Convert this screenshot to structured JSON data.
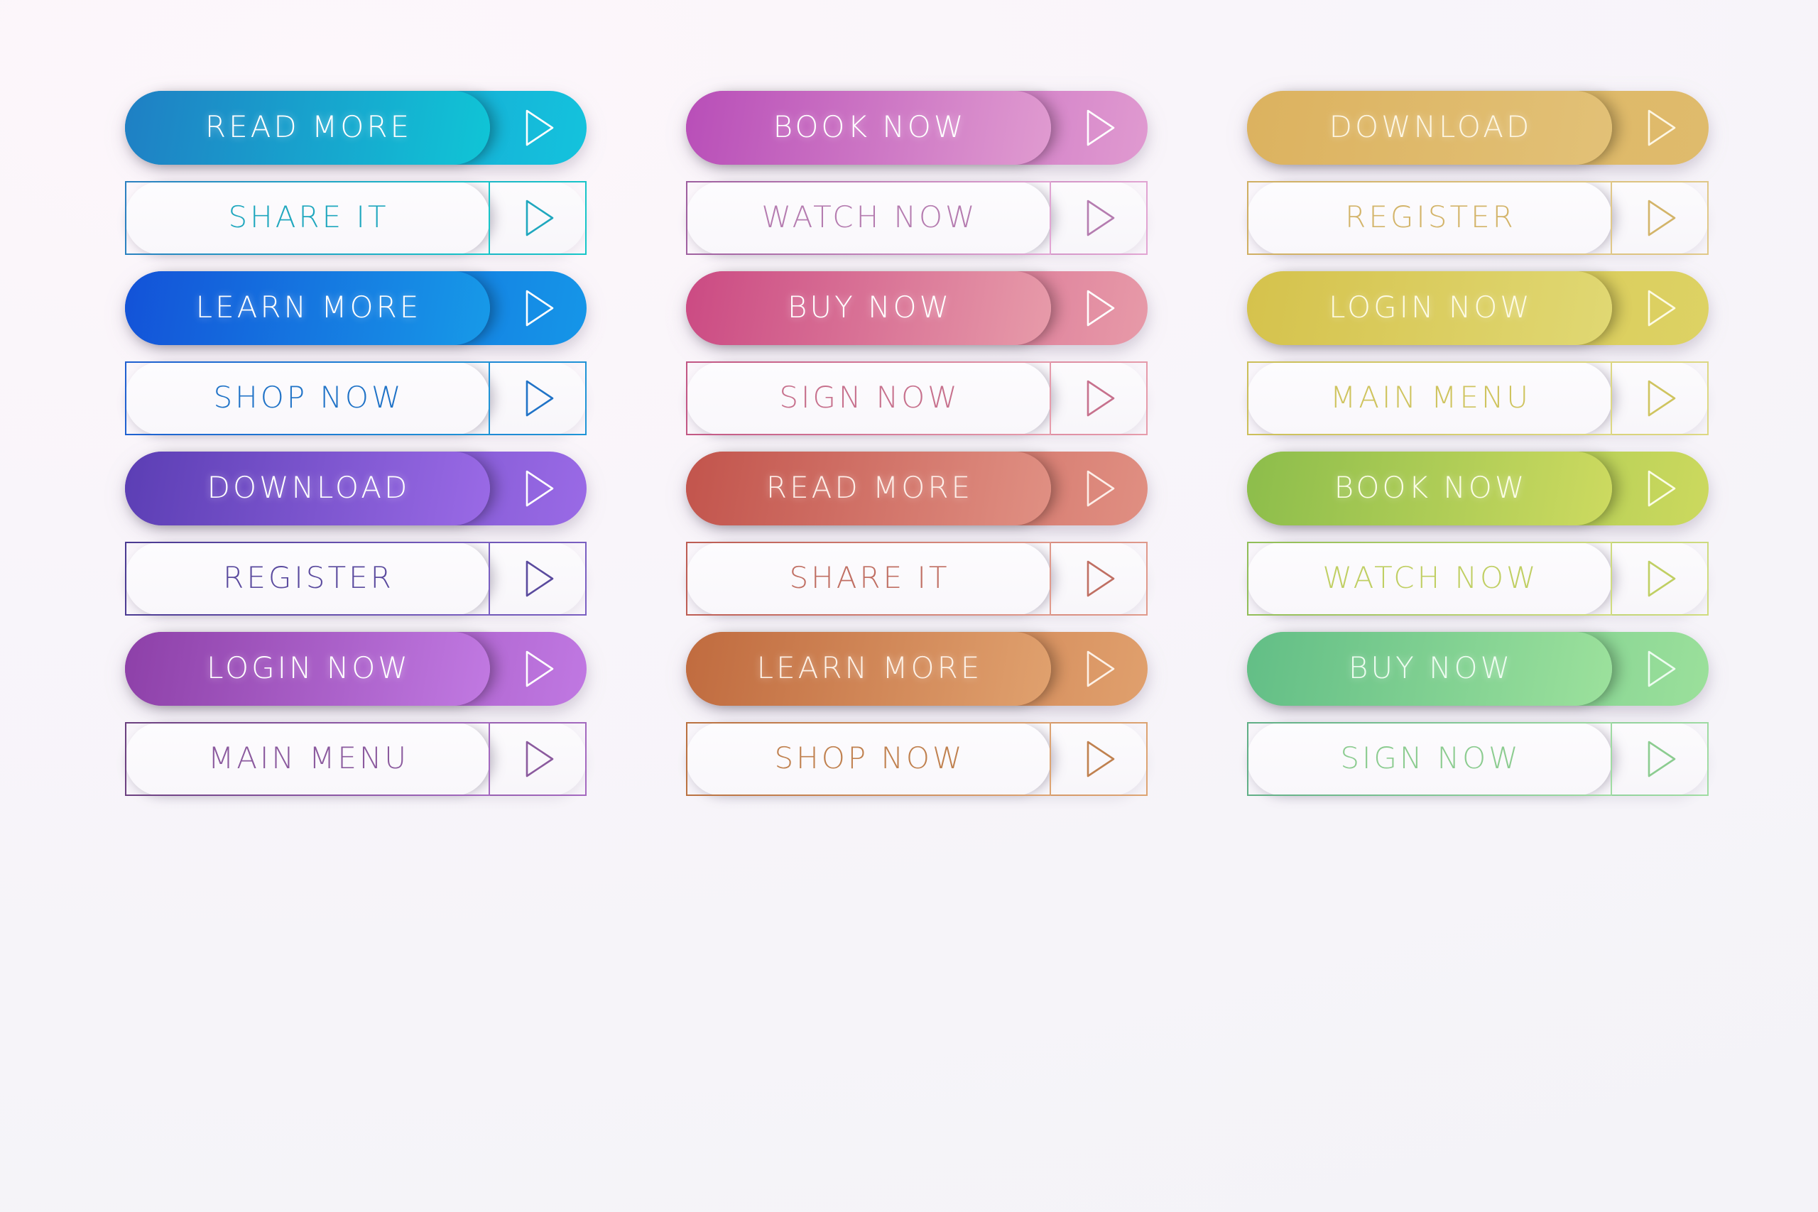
{
  "page": {
    "title": "Modern Call-To-Action Button Set",
    "background_color": "#f7f5fa",
    "columns": 3,
    "rows": 8,
    "arrow_icon": "play-triangle-outline-icon"
  },
  "columns": [
    {
      "name": "blue-purple-column",
      "buttons": [
        {
          "label": "READ MORE",
          "style": "filled",
          "outer_gradient": [
            "#1c86c8",
            "#14c3dd"
          ],
          "inner_gradient": [
            "#1f7fc4",
            "#10c5d6"
          ],
          "accent": "#15a8d2",
          "text_color": "#ffffff",
          "arrow_color": "#ffffff"
        },
        {
          "label": "SHARE IT",
          "style": "outline",
          "border_gradient": [
            "#2b7fc0",
            "#15c6c8"
          ],
          "accent": "#1fa3c4",
          "text_color": "#1fa7be",
          "arrow_color": "#1fa7be"
        },
        {
          "label": "LEARN MORE",
          "style": "filled",
          "outer_gradient": [
            "#1453d6",
            "#1596e8"
          ],
          "inner_gradient": [
            "#1352d8",
            "#179ae8"
          ],
          "accent": "#1470de",
          "text_color": "#ffffff",
          "arrow_color": "#ffffff"
        },
        {
          "label": "SHOP NOW",
          "style": "outline",
          "border_gradient": [
            "#1f5fd0",
            "#1e94d6"
          ],
          "accent": "#2174cf",
          "text_color": "#2073c7",
          "arrow_color": "#2073c7"
        },
        {
          "label": "DOWNLOAD",
          "style": "filled",
          "outer_gradient": [
            "#5a3fb3",
            "#9a6ae6"
          ],
          "inner_gradient": [
            "#5b3eb4",
            "#9a6ae6"
          ],
          "accent": "#7450cc",
          "text_color": "#ffffff",
          "arrow_color": "#ffffff"
        },
        {
          "label": "REGISTER",
          "style": "outline",
          "border_gradient": [
            "#4a3a91",
            "#7a5fc2"
          ],
          "accent": "#5b4aa4",
          "text_color": "#5a4a9e",
          "arrow_color": "#5a4a9e"
        },
        {
          "label": "LOGIN NOW",
          "style": "filled",
          "outer_gradient": [
            "#8c3fa8",
            "#c078e2"
          ],
          "inner_gradient": [
            "#8d40a8",
            "#c179e2"
          ],
          "accent": "#a75cc5",
          "text_color": "#ffffff",
          "arrow_color": "#ffffff"
        },
        {
          "label": "MAIN MENU",
          "style": "outline",
          "border_gradient": [
            "#6a3f7e",
            "#a469c0"
          ],
          "accent": "#875099",
          "text_color": "#8b5a9e",
          "arrow_color": "#8b5a9e"
        }
      ]
    },
    {
      "name": "pink-orange-column",
      "buttons": [
        {
          "label": "BOOK NOW",
          "style": "filled",
          "outer_gradient": [
            "#b84db8",
            "#e09ad0"
          ],
          "inner_gradient": [
            "#b84eb8",
            "#e09bd0"
          ],
          "accent": "#cb6cc4",
          "text_color": "#ffffff",
          "arrow_color": "#ffffff"
        },
        {
          "label": "WATCH NOW",
          "style": "outline",
          "border_gradient": [
            "#9d5e9e",
            "#e2a5d3"
          ],
          "accent": "#bb7ab5",
          "text_color": "#b57cb0",
          "arrow_color": "#b57cb0"
        },
        {
          "label": "BUY NOW",
          "style": "filled",
          "outer_gradient": [
            "#cc4a82",
            "#e79aa8"
          ],
          "inner_gradient": [
            "#cb4a83",
            "#e79ba9"
          ],
          "accent": "#d96f94",
          "text_color": "#ffffff",
          "arrow_color": "#ffffff"
        },
        {
          "label": "SIGN NOW",
          "style": "outline",
          "border_gradient": [
            "#c15583",
            "#e69cab"
          ],
          "accent": "#d07595",
          "text_color": "#c7718d",
          "arrow_color": "#c7718d"
        },
        {
          "label": "READ MORE",
          "style": "filled",
          "outer_gradient": [
            "#c2544c",
            "#e08f82"
          ],
          "inner_gradient": [
            "#c2544c",
            "#e09083"
          ],
          "accent": "#d06e63",
          "text_color": "#fdeee8",
          "arrow_color": "#fdeee8"
        },
        {
          "label": "SHARE IT",
          "style": "outline",
          "border_gradient": [
            "#bc5b52",
            "#e09a8c"
          ],
          "accent": "#c87063",
          "text_color": "#c06f63",
          "arrow_color": "#c06f63"
        },
        {
          "label": "LEARN MORE",
          "style": "filled",
          "outer_gradient": [
            "#c06a3e",
            "#e0a06d"
          ],
          "inner_gradient": [
            "#c06b3f",
            "#e0a16e"
          ],
          "accent": "#cf8553",
          "text_color": "#fdf1e6",
          "arrow_color": "#fdf1e6"
        },
        {
          "label": "SHOP NOW",
          "style": "outline",
          "border_gradient": [
            "#b9703f",
            "#dda473"
          ],
          "accent": "#c5855a",
          "text_color": "#c0814f",
          "arrow_color": "#c0814f"
        }
      ]
    },
    {
      "name": "gold-green-column",
      "buttons": [
        {
          "label": "DOWNLOAD",
          "style": "filled",
          "outer_gradient": [
            "#ddb562",
            "#dfbb6c"
          ],
          "inner_gradient": [
            "#dcb25f",
            "#e2c177"
          ],
          "accent": "#debb6a",
          "text_color": "#fdf6e3",
          "arrow_color": "#fdf6e3"
        },
        {
          "label": "REGISTER",
          "style": "outline",
          "border_gradient": [
            "#cfae62",
            "#e0c888"
          ],
          "accent": "#d6b86f",
          "text_color": "#d3b469",
          "arrow_color": "#d3b469"
        },
        {
          "label": "LOGIN NOW",
          "style": "filled",
          "outer_gradient": [
            "#d6c44e",
            "#ddd264"
          ],
          "inner_gradient": [
            "#d5c24c",
            "#e0d873"
          ],
          "accent": "#d9cb58",
          "text_color": "#fdfbe4",
          "arrow_color": "#fdfbe4"
        },
        {
          "label": "MAIN MENU",
          "style": "outline",
          "border_gradient": [
            "#cbbe58",
            "#ddd883"
          ],
          "accent": "#d2c765",
          "text_color": "#cfc45f",
          "arrow_color": "#cfc45f"
        },
        {
          "label": "BOOK NOW",
          "style": "filled",
          "outer_gradient": [
            "#8cbc4a",
            "#ccd95e"
          ],
          "inner_gradient": [
            "#8cbd4b",
            "#cdda60"
          ],
          "accent": "#accb54",
          "text_color": "#fbfde6",
          "arrow_color": "#fbfde6"
        },
        {
          "label": "WATCH NOW",
          "style": "outline",
          "border_gradient": [
            "#8fbd57",
            "#d0dc7f"
          ],
          "accent": "#aecb6a",
          "text_color": "#c0cf63",
          "arrow_color": "#c0cf63"
        },
        {
          "label": "BUY NOW",
          "style": "filled",
          "outer_gradient": [
            "#62bd85",
            "#9be09b"
          ],
          "inner_gradient": [
            "#62be86",
            "#9ce19c"
          ],
          "accent": "#7ecf90",
          "text_color": "#edfcf0",
          "arrow_color": "#edfcf0"
        },
        {
          "label": "SIGN NOW",
          "style": "outline",
          "border_gradient": [
            "#5fae86",
            "#a0dca3"
          ],
          "accent": "#7cc294",
          "text_color": "#8ccc90",
          "arrow_color": "#8ccc90"
        }
      ]
    }
  ]
}
